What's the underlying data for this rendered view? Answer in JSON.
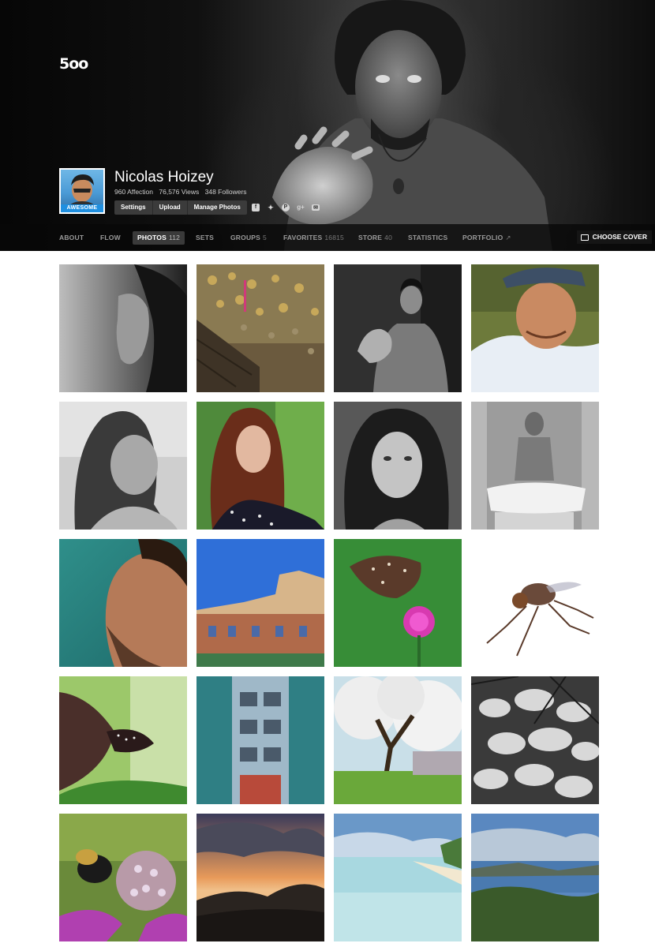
{
  "brand": {
    "logo_text": "5oo"
  },
  "profile": {
    "name": "Nicolas Hoizey",
    "avatar_badge": "AWESOME",
    "stats": {
      "affection": "960 Affection",
      "views": "76,576 Views",
      "followers": "348 Followers"
    },
    "actions": [
      "Settings",
      "Upload",
      "Manage Photos"
    ],
    "social_icons": [
      "facebook-icon",
      "twitter-icon",
      "pinterest-icon",
      "google-plus-icon",
      "email-icon"
    ]
  },
  "nav": {
    "items": [
      {
        "label": "ABOUT",
        "count": ""
      },
      {
        "label": "FLOW",
        "count": ""
      },
      {
        "label": "PHOTOS",
        "count": "112"
      },
      {
        "label": "SETS",
        "count": ""
      },
      {
        "label": "GROUPS",
        "count": "5"
      },
      {
        "label": "FAVORITES",
        "count": "16815"
      },
      {
        "label": "STORE",
        "count": "40"
      },
      {
        "label": "STATISTICS",
        "count": ""
      },
      {
        "label": "PORTFOLIO",
        "count": "↗"
      }
    ],
    "active": "PHOTOS",
    "choose_cover": "CHOOSE COVER"
  },
  "photos": [
    "bw-woman-profile",
    "love-locks-bridge",
    "bw-man-reaching-hand",
    "smiling-man-in-cap",
    "bw-woman-looking-down",
    "red-haired-woman-outdoors",
    "bw-woman-portrait",
    "bw-man-meditating",
    "man-profile-closeup",
    "building-blue-sky",
    "butterfly-on-pink-flower",
    "fly-on-white",
    "butterfly-on-leaf",
    "glass-building-facade",
    "blossoming-tree",
    "bw-snowy-rocks",
    "bee-on-flower",
    "sunset-over-hills",
    "shallow-lagoon-beach",
    "coastal-landscape"
  ]
}
